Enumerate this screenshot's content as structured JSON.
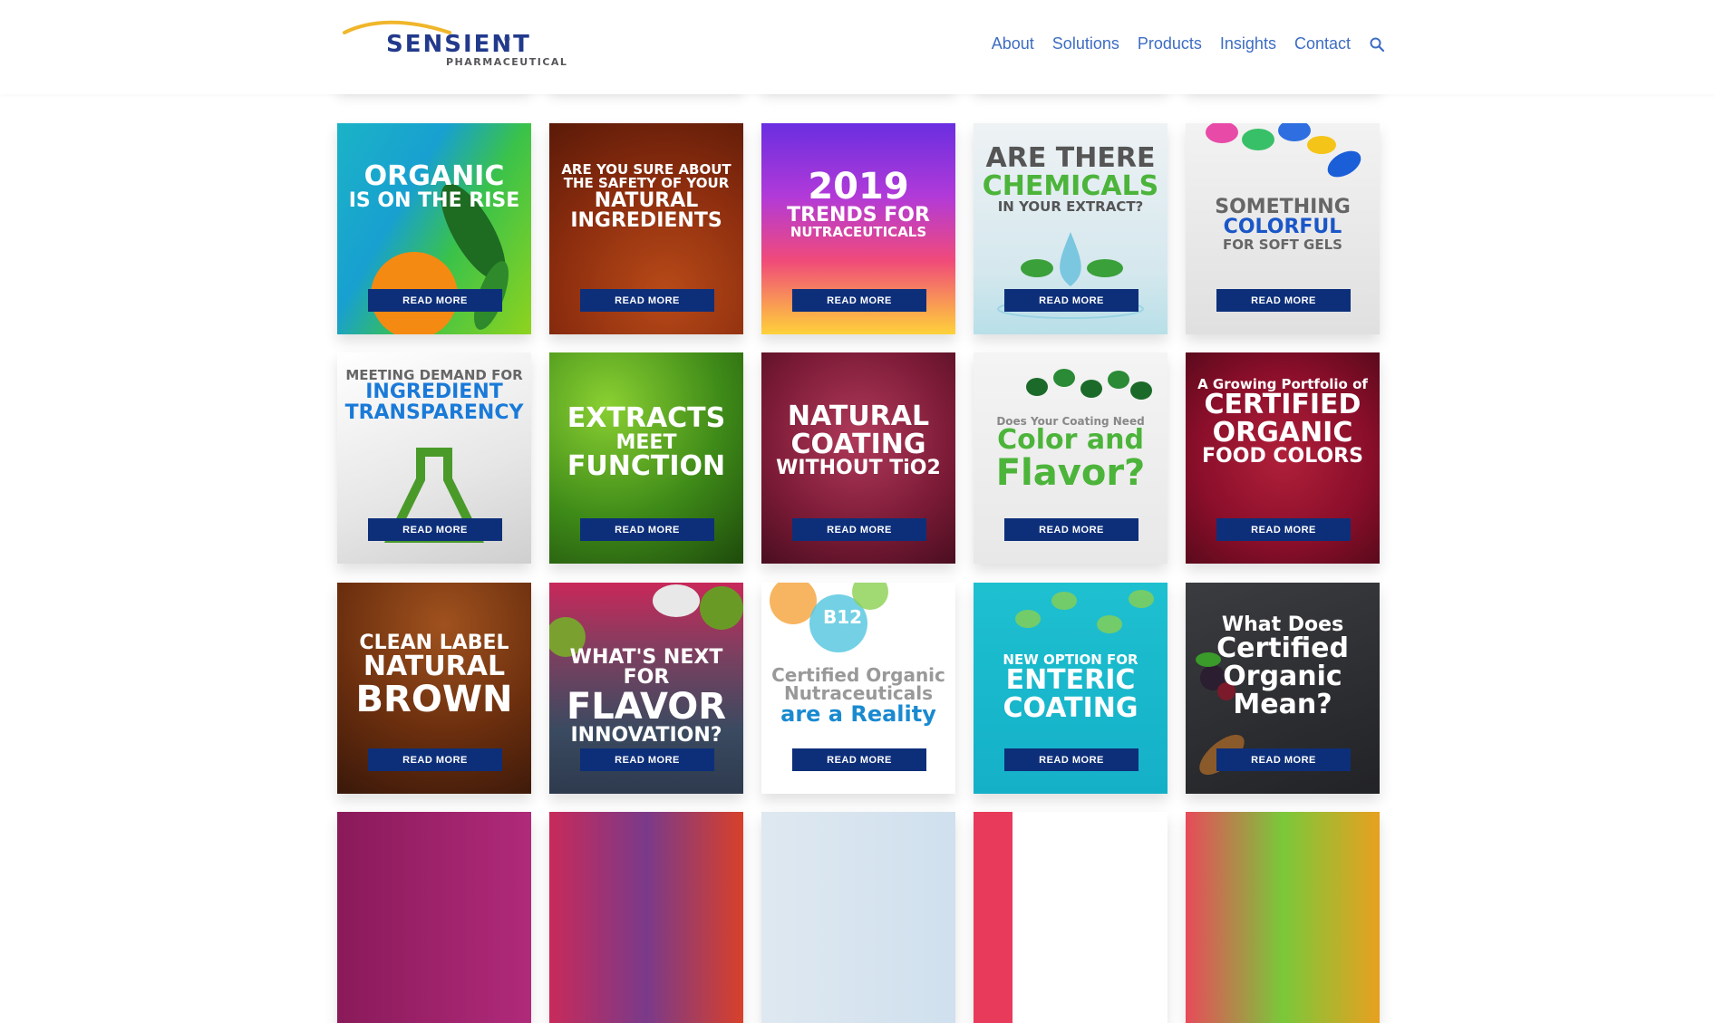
{
  "brand": {
    "name": "SENSIENT",
    "reg": "®",
    "sub": "PHARMACEUTICAL",
    "accent": "#223a8c",
    "swoosh": "#f0b62a"
  },
  "nav": {
    "items": [
      "About",
      "Solutions",
      "Products",
      "Insights",
      "Contact"
    ]
  },
  "button_color": "#0d2f7a",
  "read_more": "READ MORE",
  "tiles": [
    {
      "lines": [
        "ORGANIC",
        "IS ON THE RISE"
      ]
    },
    {
      "lines": [
        "ARE YOU SURE ABOUT",
        "THE SAFETY OF YOUR",
        "NATURAL",
        "INGREDIENTS"
      ]
    },
    {
      "lines": [
        "2019",
        "TRENDS FOR",
        "NUTRACEUTICALS"
      ]
    },
    {
      "lines": [
        "ARE THERE",
        "CHEMICALS",
        "IN YOUR EXTRACT?"
      ]
    },
    {
      "lines": [
        "SOMETHING",
        "COLORFUL",
        "FOR SOFT GELS"
      ]
    },
    {
      "lines": [
        "MEETING DEMAND FOR",
        "INGREDIENT",
        "TRANSPARENCY"
      ]
    },
    {
      "lines": [
        "EXTRACTS",
        "MEET",
        "FUNCTION"
      ]
    },
    {
      "lines": [
        "NATURAL",
        "COATING",
        "WITHOUT TiO2"
      ]
    },
    {
      "lines": [
        "Does Your Coating Need",
        "Color and",
        "Flavor?"
      ]
    },
    {
      "lines": [
        "A Growing Portfolio of",
        "CERTIFIED",
        "ORGANIC",
        "FOOD COLORS"
      ]
    },
    {
      "lines": [
        "CLEAN LABEL",
        "NATURAL",
        "BROWN"
      ]
    },
    {
      "lines": [
        "WHAT'S NEXT FOR",
        "FLAVOR",
        "INNOVATION?"
      ]
    },
    {
      "lines": [
        "Certified Organic",
        "Nutraceuticals",
        "are a Reality"
      ],
      "badge": "B12"
    },
    {
      "lines": [
        "NEW OPTION FOR",
        "ENTERIC",
        "COATING"
      ]
    },
    {
      "lines": [
        "What Does",
        "Certified",
        "Organic",
        "Mean?"
      ]
    }
  ]
}
